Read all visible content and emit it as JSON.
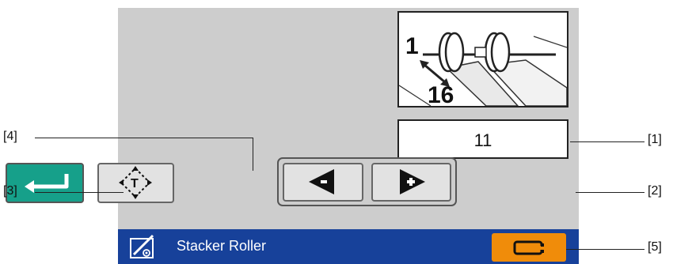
{
  "status_bar": {
    "title": "Stacker Roller",
    "icon": "pen-settings-icon",
    "color": "#17419a"
  },
  "diagram": {
    "label_top": "1",
    "label_bottom": "16"
  },
  "value_display": {
    "value": "11"
  },
  "buttons": {
    "enter": {
      "icon": "enter-return-icon",
      "color": "#16a08a"
    },
    "text": {
      "icon": "text-move-icon"
    },
    "decrease": {
      "icon": "arrow-left-icon"
    },
    "increase": {
      "icon": "arrow-right-icon"
    },
    "maintenance": {
      "icon": "maintenance-icon",
      "color": "#f08c0a"
    }
  },
  "callouts": {
    "c1": "[1]",
    "c2": "[2]",
    "c3": "[3]",
    "c4": "[4]",
    "c5": "[5]"
  }
}
